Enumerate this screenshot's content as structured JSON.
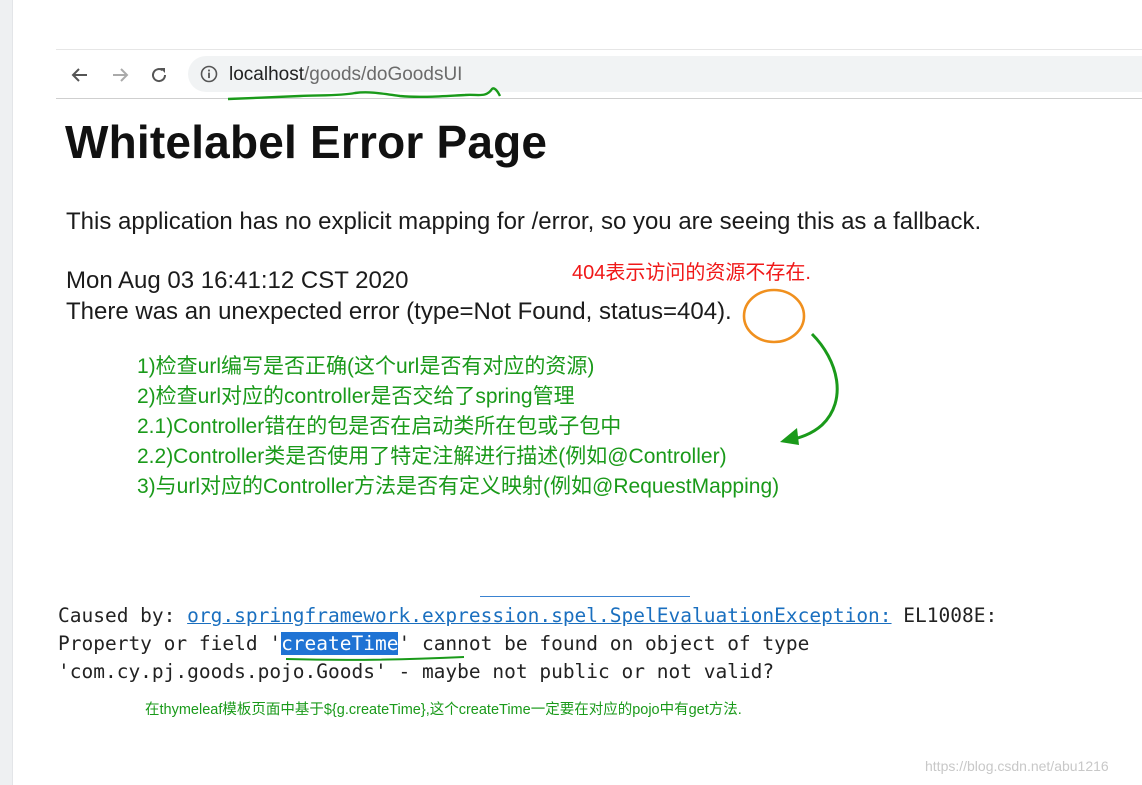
{
  "browser": {
    "url_host": "localhost",
    "url_path": "/goods/doGoodsUI"
  },
  "page": {
    "title": "Whitelabel Error Page",
    "fallback_text": "This application has no explicit mapping for /error, so you are seeing this as a fallback.",
    "timestamp": "Mon Aug 03 16:41:12 CST 2020",
    "error_prefix": "There was an unexpected error (type=Not Found, status=",
    "error_status": "404",
    "error_suffix": ")."
  },
  "annotations": {
    "status_note": "404表示访问的资源不存在.",
    "checklist": [
      "1)检查url编写是否正确(这个url是否有对应的资源)",
      "2)检查url对应的controller是否交给了spring管理",
      "2.1)Controller错在的包是否在启动类所在包或子包中",
      "2.2)Controller类是否使用了特定注解进行描述(例如@Controller)",
      "3)与url对应的Controller方法是否有定义映射(例如@RequestMapping)"
    ],
    "thymeleaf_note": "在thymeleaf模板页面中基于${g.createTime},这个createTime一定要在对应的pojo中有get方法."
  },
  "trace": {
    "caused_by": "Caused by: ",
    "exception": "org.springframework.expression.spel.SpelEvaluationException:",
    "code": " EL1008E:",
    "line2_pre": "Property or field '",
    "line2_highlight": "createTime",
    "line2_post": "' cannot be found on object of type",
    "line3": "'com.cy.pj.goods.pojo.Goods' - maybe not public or not valid?"
  },
  "watermark": "https://blog.csdn.net/abu1216",
  "colors": {
    "annotation_red": "#f01818",
    "annotation_green": "#1a9a1a",
    "circle_orange": "#f0901e",
    "link_blue": "#1a6fbf",
    "highlight_blue": "#1f73d4"
  }
}
